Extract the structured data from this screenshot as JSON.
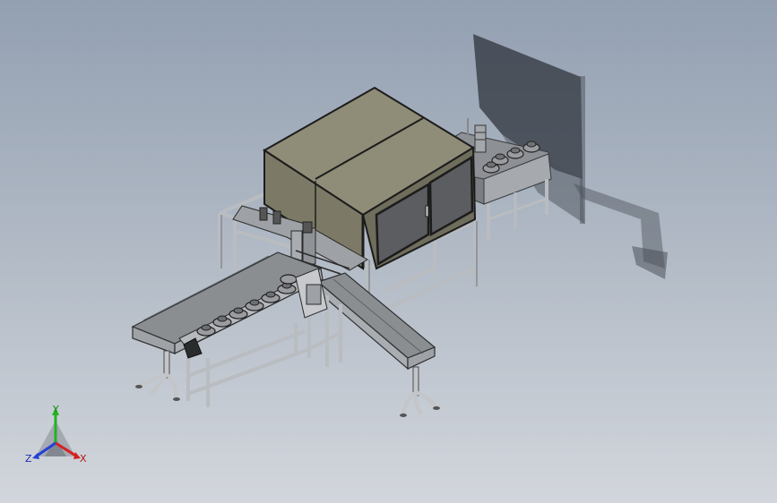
{
  "viewport": {
    "background_top": "#93a0b2",
    "background_bottom": "#d2d6dc"
  },
  "triad": {
    "x_label": "X",
    "y_label": "Y",
    "z_label": "Z",
    "x_color": "#d62020",
    "y_color": "#22b322",
    "z_color": "#2440d8"
  },
  "colors": {
    "frame": "#b9bcc0",
    "frame_dark": "#6e7276",
    "cabinet_top": "#8f8d78",
    "cabinet_side": "#7c7a66",
    "cabinet_edge": "#1c1c1c",
    "belt": "#8b8e91",
    "shadow": "#2a2e34"
  },
  "icons": {
    "triad": "coordinate-triad-icon"
  }
}
